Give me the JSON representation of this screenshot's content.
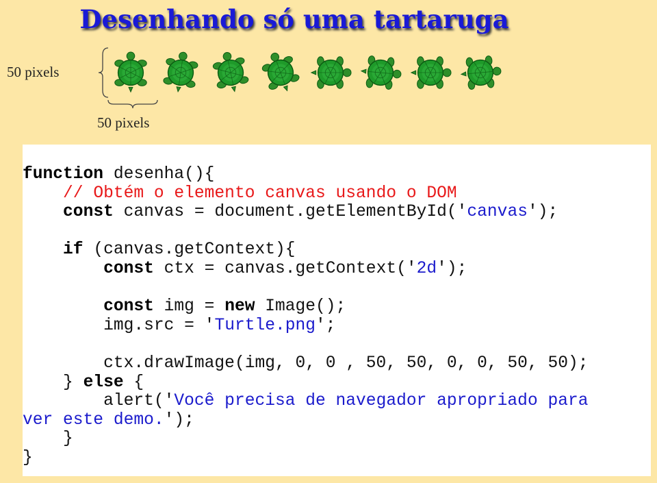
{
  "title": "Desenhando só uma tartaruga",
  "dimension_labels": {
    "height": "50 pixels",
    "width": "50 pixels"
  },
  "turtle_icon": "turtle-icon",
  "turtle_count": 8,
  "colors": {
    "background": "#fde7a6",
    "title": "#1a1ad6",
    "comment": "#e8191a",
    "string": "#1b1bcc"
  },
  "code": {
    "fn_kw": "function",
    "fn_sig": " desenha(){",
    "comment": "// Obtém o elemento canvas usando o DOM",
    "const1_kw": "const",
    "const1_a": " canvas = document.getElementById('",
    "const1_str": "canvas",
    "const1_b": "');",
    "if_kw": "if",
    "if_rest": " (canvas.getContext){",
    "const2_kw": "const",
    "const2_a": " ctx = canvas.getContext('",
    "const2_str": "2d",
    "const2_b": "');",
    "const3_kw": "const",
    "const3_a": " img = ",
    "new_kw": "new",
    "const3_b": " Image();",
    "src_a": "img.src = '",
    "src_str": "Turtle.png",
    "src_b": "';",
    "draw": "ctx.drawImage(img, 0, 0 , 50, 50, 0, 0, 50, 50);",
    "else_a": "} ",
    "else_kw": "else",
    "else_b": " {",
    "alert_a": "alert('",
    "alert_str1": "Você precisa de navegador apropriado para",
    "alert_str2": "ver este demo.",
    "alert_b": "');",
    "close_inner": "}",
    "close_outer": "}"
  }
}
